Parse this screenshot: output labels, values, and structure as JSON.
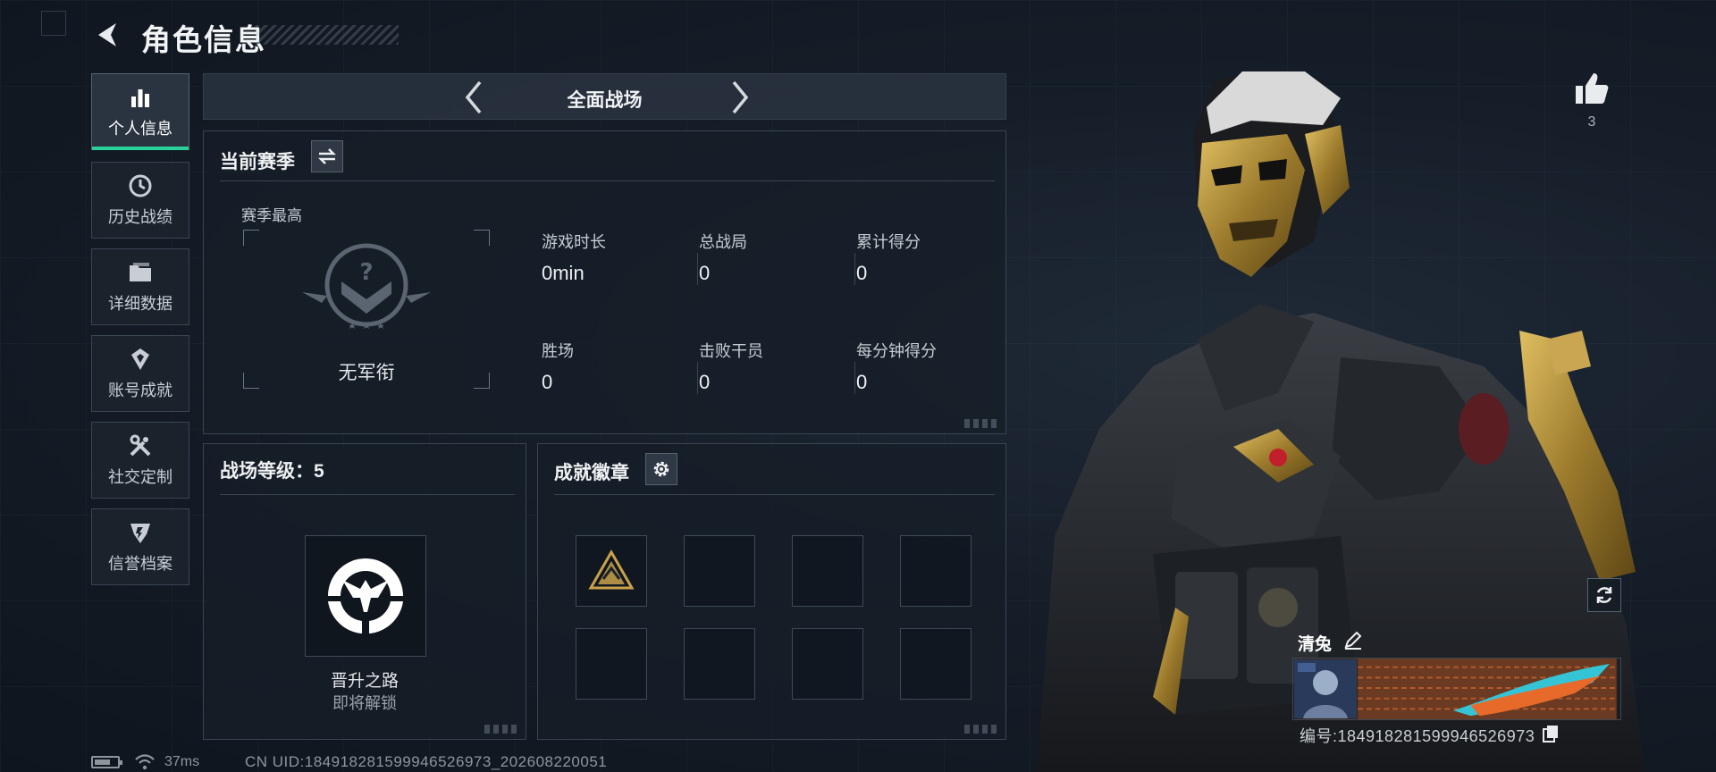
{
  "header": {
    "title": "角色信息"
  },
  "sidebar": {
    "items": [
      {
        "label": "个人信息",
        "icon": "bar-chart-icon",
        "active": true
      },
      {
        "label": "历史战绩",
        "icon": "history-icon",
        "active": false
      },
      {
        "label": "详细数据",
        "icon": "folder-icon",
        "active": false
      },
      {
        "label": "账号成就",
        "icon": "achievement-icon",
        "active": false
      },
      {
        "label": "社交定制",
        "icon": "tools-icon",
        "active": false
      },
      {
        "label": "信誉档案",
        "icon": "shield-icon",
        "active": false
      }
    ]
  },
  "mode": {
    "label": "全面战场"
  },
  "season": {
    "title": "当前赛季",
    "best_label": "赛季最高",
    "rank_name": "无军衔",
    "stats": [
      {
        "label": "游戏时长",
        "value": "0min"
      },
      {
        "label": "总战局",
        "value": "0"
      },
      {
        "label": "累计得分",
        "value": "0"
      },
      {
        "label": "胜场",
        "value": "0"
      },
      {
        "label": "击败干员",
        "value": "0"
      },
      {
        "label": "每分钟得分",
        "value": "0"
      }
    ]
  },
  "level": {
    "title": "战场等级：5",
    "badge_name": "晋升之路",
    "badge_status": "即将解锁"
  },
  "achievements": {
    "title": "成就徽章",
    "slot_count": 8
  },
  "profile": {
    "likes": "3",
    "name": "清兔",
    "id_text": "编号:1849182815999465269​73"
  },
  "status": {
    "ping": "37ms",
    "uid": "CN UID:1849182815999465269​73_202608220051"
  },
  "colors": {
    "accent": "#2bd19a",
    "gold": "#c9a24a",
    "panel_border": "#3a4552"
  }
}
